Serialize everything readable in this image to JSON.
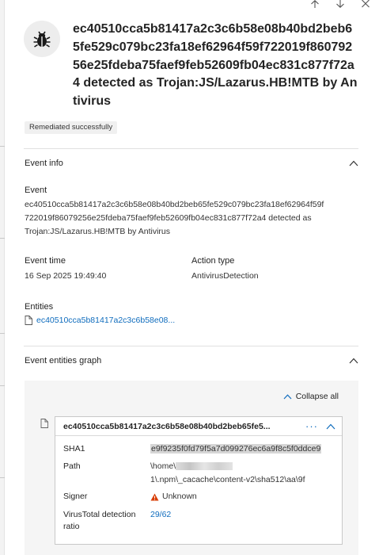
{
  "nav": {
    "icons": [
      "arrow-up-icon",
      "arrow-down-icon",
      "close-icon"
    ]
  },
  "header": {
    "title": "ec40510cca5b81417a2c3c6b58e08b40bd2beb65fe529c079bc23fa18ef62964f59f722019f86079256e25fdeba75faef9feb52609fb04ec831c877f72a4 detected as Trojan:JS/Lazarus.HB!MTB by Antivirus",
    "status_badge": "Remediated successfully"
  },
  "event_info": {
    "section_title": "Event info",
    "event_label": "Event",
    "event_value_lines": [
      "ec40510cca5b81417a2c3c6b58e08b40bd2beb65fe529c079bc23fa18ef62964f59f",
      "722019f86079256e25fdeba75faef9feb52609fb04ec831c877f72a4 detected as",
      "Trojan:JS/Lazarus.HB!MTB by Antivirus"
    ],
    "event_time_label": "Event time",
    "event_time_value": "16 Sep 2025 19:49:40",
    "action_type_label": "Action type",
    "action_type_value": "AntivirusDetection",
    "entities_label": "Entities",
    "entity_link": "ec40510cca5b81417a2c3c6b58e08..."
  },
  "graph": {
    "section_title": "Event entities graph",
    "collapse_all": "Collapse all",
    "card": {
      "title": "ec40510cca5b81417a2c3c6b58e08b40bd2beb65fe5...",
      "more": "···",
      "sha1_label": "SHA1",
      "sha1_value": "e9f9235f0fd79f5a7d099276ec6a9f8c5f0ddce9",
      "path_label": "Path",
      "path_line1_prefix": "\\home\\",
      "path_line2": "1\\.npm\\_cacache\\content-v2\\sha512\\aa\\9f",
      "signer_label": "Signer",
      "signer_value": "Unknown",
      "vt_label_line1": "VirusTotal detection",
      "vt_label_line2": "ratio",
      "vt_value": "29/62"
    }
  },
  "colors": {
    "accent": "#0f6cbd",
    "warning": "#d83b01",
    "panel_bg": "#f5f5f5",
    "badge_bg": "#f0f0f0"
  }
}
